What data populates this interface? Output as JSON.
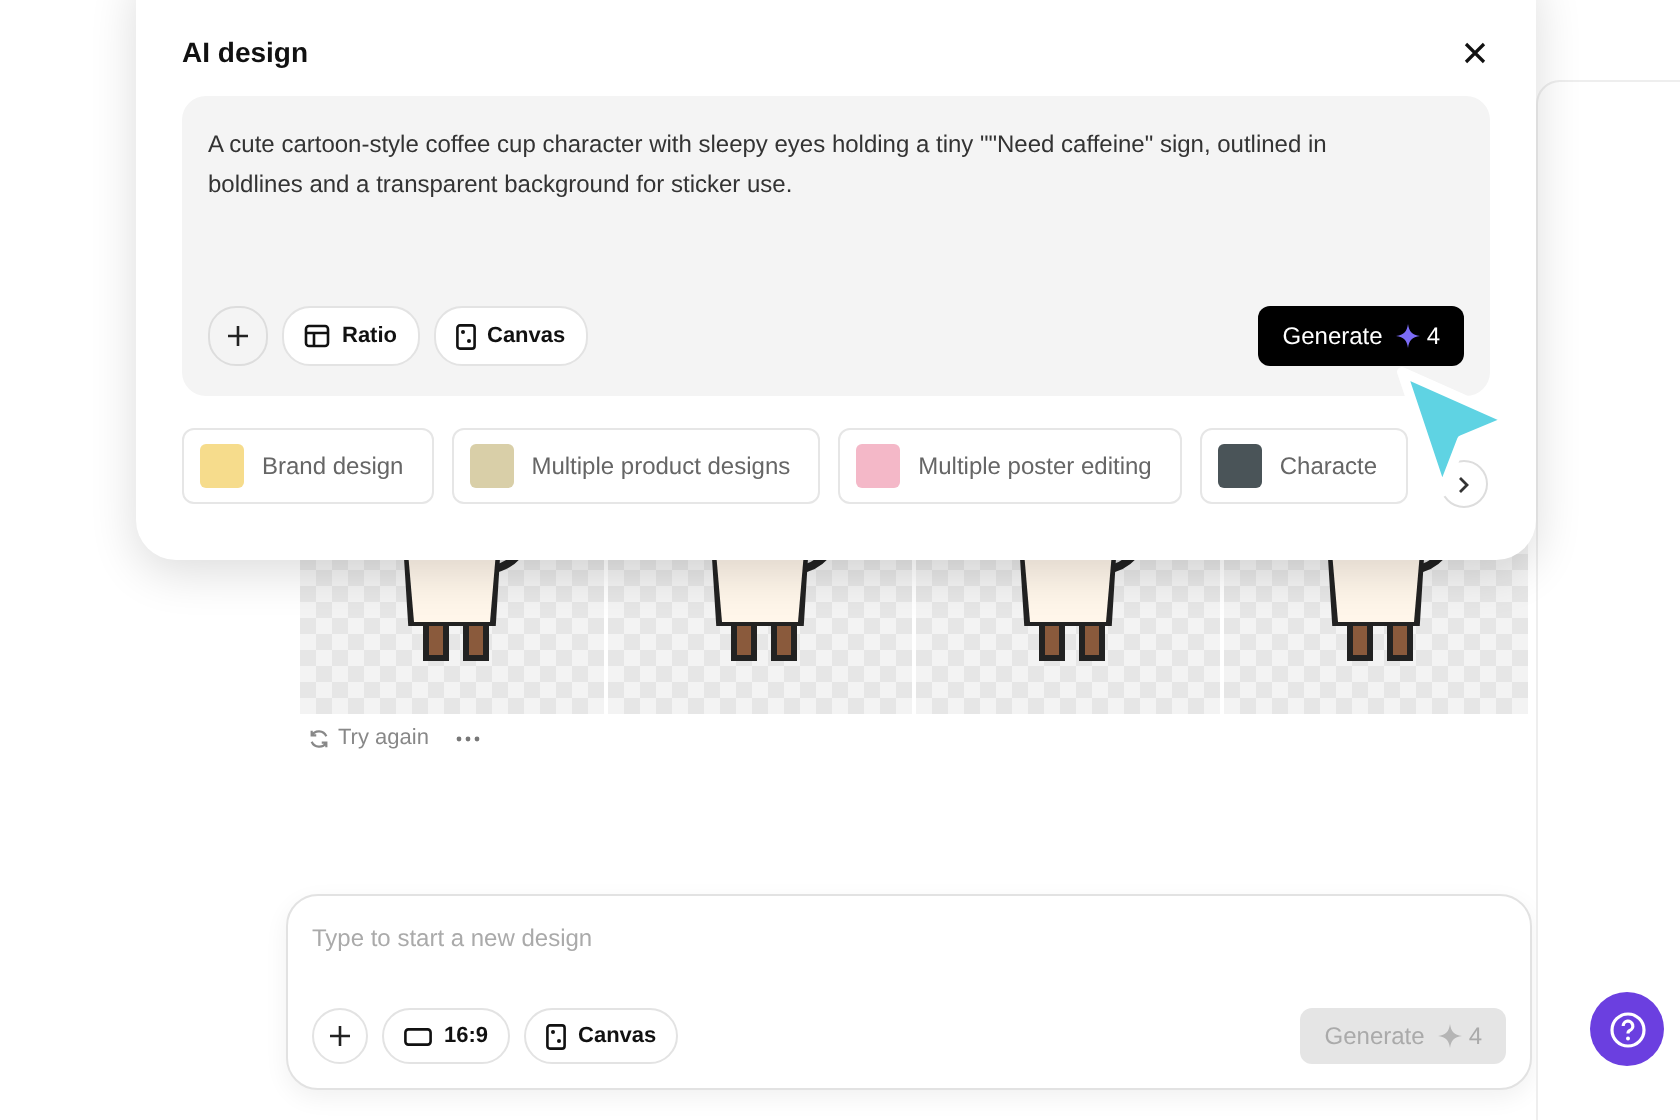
{
  "modal": {
    "title": "AI design",
    "prompt": {
      "value": "A cute cartoon-style coffee cup character with sleepy eyes holding a tiny \"\"Need caffeine\" sign, outlined in boldlines and a transparent background for sticker use.",
      "tools": [
        {
          "kind": "add"
        },
        {
          "kind": "ratio",
          "label": "Ratio"
        },
        {
          "kind": "canvas",
          "label": "Canvas"
        }
      ],
      "generate": {
        "label": "Generate",
        "credits": "4",
        "disabled": false
      }
    },
    "suggestions": [
      {
        "label": "Brand design"
      },
      {
        "label": "Multiple product designs"
      },
      {
        "label": "Multiple poster editing"
      },
      {
        "label": "Characte"
      }
    ]
  },
  "results": {
    "images": [
      {
        "kind": "sticker"
      },
      {
        "kind": "sticker"
      },
      {
        "kind": "sticker"
      },
      {
        "kind": "sticker"
      }
    ],
    "actions": [
      {
        "kind": "retry",
        "label": "Try again"
      },
      {
        "kind": "more"
      }
    ]
  },
  "composer": {
    "placeholder": "Type to start a new design",
    "tools": [
      {
        "kind": "add"
      },
      {
        "kind": "frame",
        "label": "16:9"
      },
      {
        "kind": "canvas",
        "label": "Canvas"
      }
    ],
    "generate": {
      "label": "Generate",
      "credits": "4",
      "disabled": true
    }
  }
}
